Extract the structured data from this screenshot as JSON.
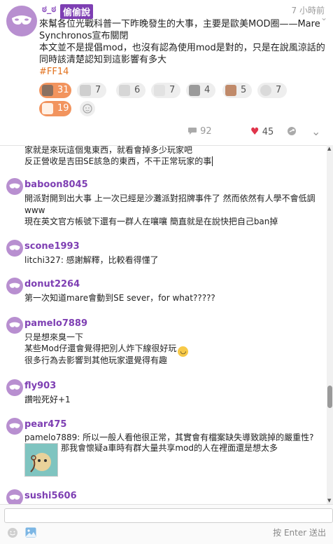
{
  "post": {
    "author": "ಠ_ಠ",
    "board": "偷偷說",
    "time": "7 小時前",
    "lines": [
      "來幫各位光戰科普一下昨晚發生的大事，主要是歐美MOD圈——Mare",
      "Synchronos宣布關閉",
      "本文並不是提倡mod，也沒有認為使用mod是對的，只是在說風涼話的",
      "同時該清楚認知到這影響有多大"
    ],
    "tag": "#FF14",
    "reactions": [
      {
        "count": "31",
        "active": true
      },
      {
        "count": "7",
        "active": false
      },
      {
        "count": "6",
        "active": false
      },
      {
        "count": "7",
        "active": false
      },
      {
        "count": "4",
        "active": false
      },
      {
        "count": "5",
        "active": false
      },
      {
        "count": "7",
        "active": false
      },
      {
        "count": "19",
        "active": true
      }
    ],
    "comment_count": "92",
    "like_count": "45"
  },
  "comments": [
    {
      "author": "",
      "lines": [
        "家就是來玩這個鬼東西，就看會掉多少玩家吧",
        "反正營收是吉田SE該急的東西，不干正常玩家的事"
      ]
    },
    {
      "author": "baboon8045",
      "lines": [
        "開派對開到出大事 上一次已經是沙灘派對招牌事件了 然而依然有人學不會低調",
        "www",
        "現在英文官方帳號下還有一群人在嚷嚷 簡直就是在說快把自己ban掉"
      ]
    },
    {
      "author": "scone1993",
      "lines": [
        "litchi327: 感謝解釋，比較看得懂了"
      ]
    },
    {
      "author": "donut2264",
      "lines": [
        "第一次知道mare會動到SE sever，for what?????"
      ]
    },
    {
      "author": "pamelo7889",
      "lines": [
        "只是想來臭一下",
        "某些Mod仔還會覺得把別人炸下線很好玩",
        "很多行為去影響到其他玩家還覺得有趣"
      ]
    },
    {
      "author": "fly903",
      "lines": [
        "讚啦死好+1"
      ]
    },
    {
      "author": "pear475",
      "lines": [
        "pamelo7889: 所以一般人看他很正常，其實會有檔案缺失導致跳掉的嚴重性?",
        "那我會懷疑a車時有群大量共享mod的人在裡面還是想太多"
      ]
    },
    {
      "author": "sushi5606",
      "lines": []
    }
  ],
  "composer": {
    "placeholder": "",
    "hint": "按 Enter 送出"
  },
  "icons": {
    "emoji": "smiley-icon",
    "image": "image-icon",
    "comment": "comment-icon",
    "like": "heart-icon",
    "share": "share-icon",
    "more": "chevron-down-icon"
  },
  "colors": {
    "accent": "#7e3fb3",
    "reaction_active": "#f2945e",
    "like": "#e0344b",
    "tag": "#e2711d"
  }
}
